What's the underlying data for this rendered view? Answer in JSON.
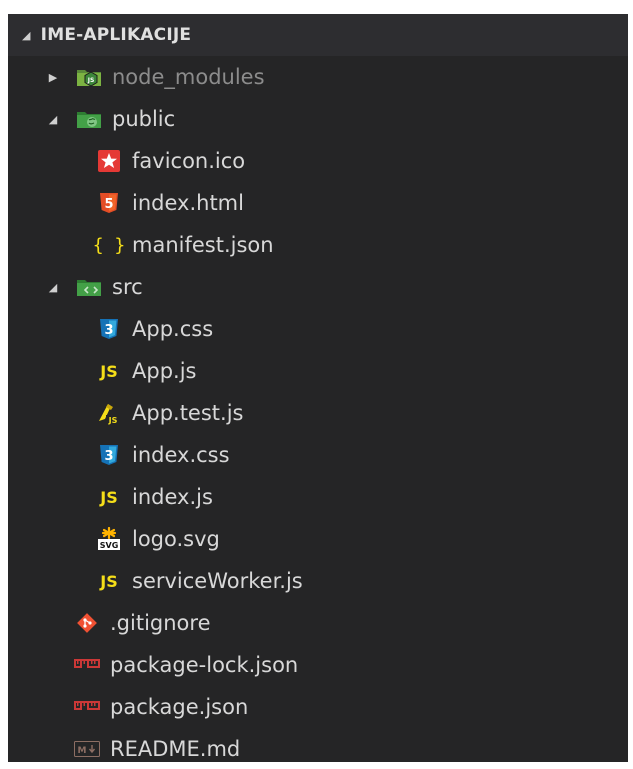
{
  "explorer": {
    "title": "IME-APLIKACIJE",
    "items": [
      {
        "label": "node_modules",
        "type": "folder",
        "icon": "node-folder-icon",
        "expanded": false,
        "depth": 0,
        "dim": true
      },
      {
        "label": "public",
        "type": "folder",
        "icon": "public-folder-icon",
        "expanded": true,
        "depth": 0
      },
      {
        "label": "favicon.ico",
        "type": "file",
        "icon": "favicon-icon",
        "depth": 1
      },
      {
        "label": "index.html",
        "type": "file",
        "icon": "html5-icon",
        "depth": 1
      },
      {
        "label": "manifest.json",
        "type": "file",
        "icon": "json-icon",
        "depth": 1
      },
      {
        "label": "src",
        "type": "folder",
        "icon": "src-folder-icon",
        "expanded": true,
        "depth": 0
      },
      {
        "label": "App.css",
        "type": "file",
        "icon": "css3-icon",
        "depth": 1
      },
      {
        "label": "App.js",
        "type": "file",
        "icon": "javascript-icon",
        "depth": 1
      },
      {
        "label": "App.test.js",
        "type": "file",
        "icon": "test-js-icon",
        "depth": 1
      },
      {
        "label": "index.css",
        "type": "file",
        "icon": "css3-icon",
        "depth": 1
      },
      {
        "label": "index.js",
        "type": "file",
        "icon": "javascript-icon",
        "depth": 1
      },
      {
        "label": "logo.svg",
        "type": "file",
        "icon": "svg-icon",
        "depth": 1
      },
      {
        "label": "serviceWorker.js",
        "type": "file",
        "icon": "javascript-icon",
        "depth": 1
      },
      {
        "label": ".gitignore",
        "type": "file",
        "icon": "git-icon",
        "depth": 0
      },
      {
        "label": "package-lock.json",
        "type": "file",
        "icon": "npm-icon",
        "depth": 0
      },
      {
        "label": "package.json",
        "type": "file",
        "icon": "npm-icon",
        "depth": 0
      },
      {
        "label": "README.md",
        "type": "file",
        "icon": "markdown-icon",
        "depth": 0
      }
    ]
  },
  "colors": {
    "background": "#252526",
    "header_background": "#2d2d30",
    "text": "#d8d8d8",
    "dim_text": "#8c8c8c",
    "js_yellow": "#f5de19",
    "html_orange": "#e44d26",
    "css_blue": "#2a7fd4",
    "git_red": "#f05133",
    "npm_red": "#cb3837",
    "folder_green": "#4caf50"
  }
}
